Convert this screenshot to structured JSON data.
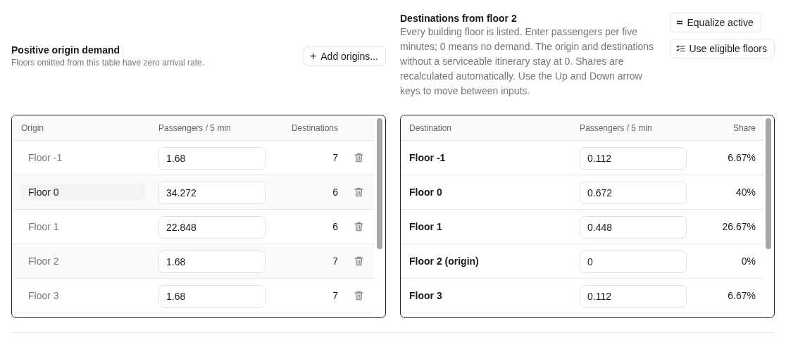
{
  "origin_panel": {
    "title": "Positive origin demand",
    "subtitle": "Floors omitted from this table have zero arrival rate.",
    "add_button": {
      "icon": "+",
      "label": "Add origins..."
    },
    "table": {
      "columns": [
        "Origin",
        "Passengers / 5 min",
        "Destinations"
      ],
      "rows": [
        {
          "origin": "Floor -1",
          "selected": false,
          "passengers": "1.68",
          "destinations": "7"
        },
        {
          "origin": "Floor 0",
          "selected": true,
          "passengers": "34.272",
          "destinations": "6"
        },
        {
          "origin": "Floor 1",
          "selected": false,
          "passengers": "22.848",
          "destinations": "6"
        },
        {
          "origin": "Floor 2",
          "selected": false,
          "passengers": "1.68",
          "destinations": "7"
        },
        {
          "origin": "Floor 3",
          "selected": false,
          "passengers": "1.68",
          "destinations": "7"
        }
      ]
    }
  },
  "destination_panel": {
    "title": "Destinations from floor 2",
    "description": "Every building floor is listed. Enter passengers per five minutes; 0 means no demand. The origin and destinations without a serviceable itinerary stay at 0. Shares are recalculated automatically. Use the Up and Down arrow keys to move between inputs.",
    "buttons": [
      {
        "kind": "equalize",
        "label": "Equalize active"
      },
      {
        "kind": "checklist",
        "label": "Use eligible floors"
      }
    ],
    "table": {
      "columns": [
        "Destination",
        "Passengers / 5 min",
        "Share"
      ],
      "rows": [
        {
          "destination": "Floor -1",
          "passengers": "0.112",
          "share": "6.67%"
        },
        {
          "destination": "Floor 0",
          "passengers": "0.672",
          "share": "40%"
        },
        {
          "destination": "Floor 1",
          "passengers": "0.448",
          "share": "26.67%"
        },
        {
          "destination": "Floor 2 (origin)",
          "passengers": "0",
          "share": "0%"
        },
        {
          "destination": "Floor 3",
          "passengers": "0.112",
          "share": "6.67%"
        }
      ]
    }
  }
}
